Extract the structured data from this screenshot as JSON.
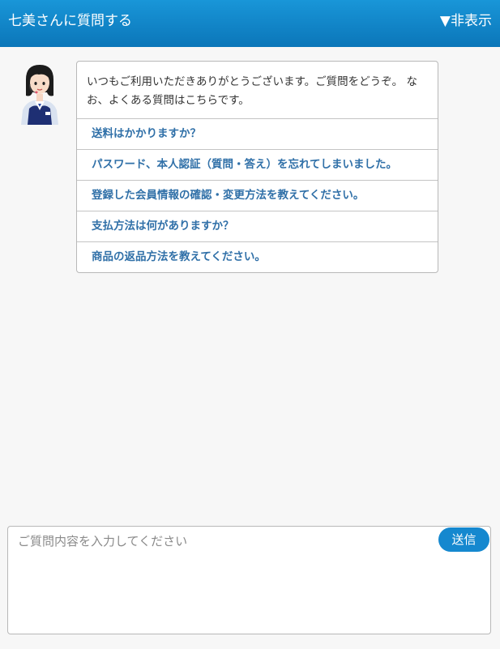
{
  "header": {
    "title": "七美さんに質問する",
    "toggle_label": "▼非表示"
  },
  "chat": {
    "message": "いつもご利用いただきありがとうございます。ご質問をどうぞ。 なお、よくある質問はこちらです。",
    "faq": [
      "送料はかかりますか？",
      "パスワード、本人認証（質問・答え）を忘れてしまいました。",
      "登録した会員情報の確認・変更方法を教えてください。",
      "支払方法は何がありますか？",
      "商品の返品方法を教えてください。"
    ]
  },
  "input": {
    "placeholder": "ご質問内容を入力してください",
    "value": "",
    "send_label": "送信"
  },
  "colors": {
    "header_top": "#1996d8",
    "header_bottom": "#0b76b9",
    "link": "#3070a8",
    "send_button": "#1588cf"
  }
}
